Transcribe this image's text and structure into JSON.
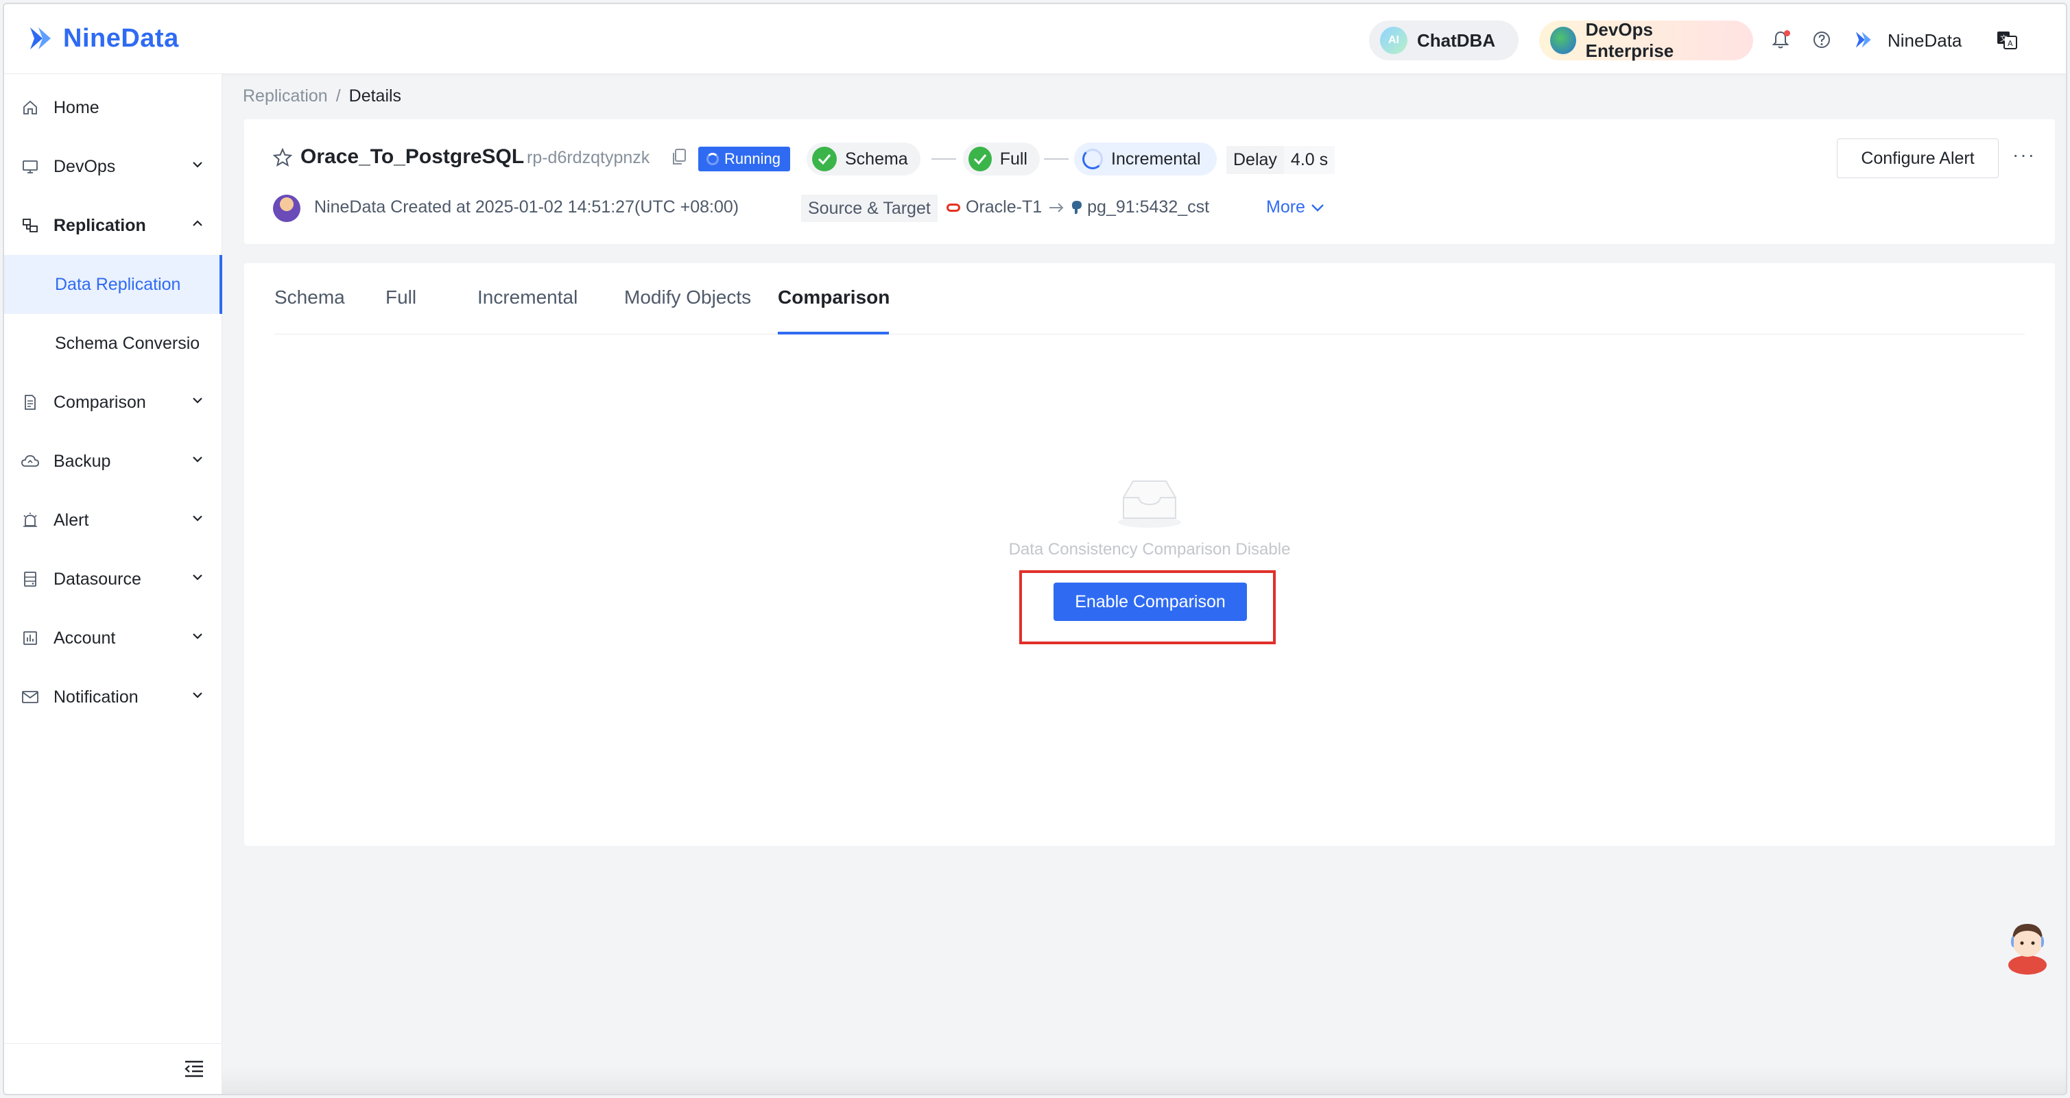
{
  "app": {
    "brand": "NineData",
    "top_pills": {
      "chatdba": "ChatDBA",
      "ai_badge": "AI",
      "devops_enterprise": "DevOps Enterprise"
    },
    "user": "NineData"
  },
  "sidebar": {
    "items": [
      {
        "label": "Home",
        "icon": "home-icon"
      },
      {
        "label": "DevOps",
        "icon": "monitor-icon"
      },
      {
        "label": "Replication",
        "icon": "replication-icon"
      },
      {
        "label": "Comparison",
        "icon": "document-icon"
      },
      {
        "label": "Backup",
        "icon": "cloud-icon"
      },
      {
        "label": "Alert",
        "icon": "alarm-icon"
      },
      {
        "label": "Datasource",
        "icon": "database-icon"
      },
      {
        "label": "Account",
        "icon": "account-icon"
      },
      {
        "label": "Notification",
        "icon": "mail-icon"
      }
    ],
    "sub_items": [
      {
        "label": "Data Replication",
        "active": true
      },
      {
        "label": "Schema Conversio",
        "active": false
      }
    ]
  },
  "breadcrumb": {
    "parent": "Replication",
    "separator": "/",
    "current": "Details"
  },
  "task": {
    "name": "Orace_To_PostgreSQL",
    "id": "rp-d6rdzqtypnzk",
    "status": "Running",
    "stages": [
      "Schema",
      "Full",
      "Incremental"
    ],
    "delay_label": "Delay",
    "delay_value": "4.0 s",
    "creator_line": "NineData Created at 2025-01-02 14:51:27(UTC +08:00)",
    "source_target_label": "Source & Target",
    "source": "Oracle-T1",
    "target": "pg_91:5432_cst",
    "more": "More",
    "configure_alert": "Configure Alert"
  },
  "tabs": [
    {
      "label": "Schema",
      "active": false
    },
    {
      "label": "Full",
      "active": false
    },
    {
      "label": "Incremental",
      "active": false
    },
    {
      "label": "Modify Objects",
      "active": false
    },
    {
      "label": "Comparison",
      "active": true
    }
  ],
  "empty_state": {
    "message": "Data Consistency Comparison Disable",
    "button": "Enable Comparison"
  },
  "colors": {
    "primary": "#2f6bf2",
    "success": "#3bb54a",
    "highlight": "#e0302a"
  }
}
